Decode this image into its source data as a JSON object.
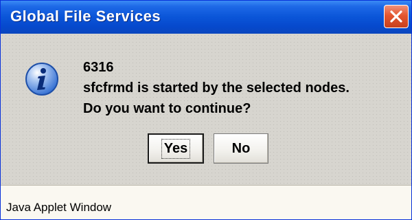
{
  "window": {
    "title": "Global File Services",
    "close_icon": "close-icon"
  },
  "message": {
    "icon": "info-icon",
    "code": "6316",
    "line1": "sfcfrmd is started by the selected nodes.",
    "line2": "Do you want to continue?"
  },
  "buttons": {
    "yes_label": "Yes",
    "no_label": "No"
  },
  "status": {
    "text": "Java Applet Window"
  },
  "colors": {
    "title_bar": "#0a55d8",
    "close_button": "#e4562f",
    "dialog_bg": "#d4d0c8",
    "status_bg": "#faf8f1"
  }
}
